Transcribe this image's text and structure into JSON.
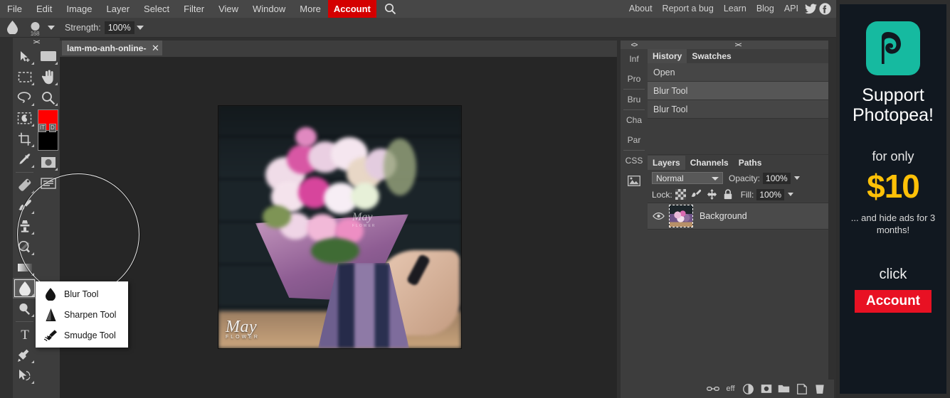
{
  "menubar": {
    "items": [
      "File",
      "Edit",
      "Image",
      "Layer",
      "Select",
      "Filter",
      "View",
      "Window",
      "More"
    ],
    "account_label": "Account",
    "search_icon": "search-icon",
    "right_links": [
      "About",
      "Report a bug",
      "Learn",
      "Blog",
      "API"
    ],
    "social": [
      "twitter-icon",
      "facebook-icon"
    ],
    "accent_red": "#d40000"
  },
  "options_bar": {
    "tool_icon": "blur-drop-icon",
    "brush_size": "168",
    "brush_preview_icon": "brush-circle-icon",
    "strength_label": "Strength:",
    "strength_value": "100%"
  },
  "toolbar": {
    "collapse_glyph": "><",
    "tools": [
      {
        "name": "move-tool",
        "icon": "arrow-move-icon",
        "selected": false
      },
      {
        "name": "artboard-tool",
        "icon": "rectangle-icon",
        "selected": false
      },
      {
        "name": "rectangular-marquee-tool",
        "icon": "dashed-rectangle-icon",
        "selected": false
      },
      {
        "name": "hand-tool",
        "icon": "hand-icon",
        "selected": false
      },
      {
        "name": "lasso-tool",
        "icon": "lasso-icon",
        "selected": false
      },
      {
        "name": "zoom-tool",
        "icon": "magnifier-icon",
        "selected": false
      },
      {
        "name": "object-selection-tool",
        "icon": "object-select-icon",
        "selected": false
      },
      {
        "name": "crop-tool",
        "icon": "crop-icon",
        "selected": false
      },
      {
        "name": "eyedropper-tool",
        "icon": "eyedropper-icon",
        "selected": false
      },
      {
        "name": "shape-tool",
        "icon": "shape-circle-icon",
        "selected": false
      },
      {
        "name": "text-block-tool",
        "icon": "text-lines-icon",
        "selected": false
      },
      {
        "name": "eraser-tool",
        "icon": "eraser-icon",
        "selected": false
      },
      {
        "name": "brush-tool",
        "icon": "paintbrush-icon",
        "selected": false
      },
      {
        "name": "clone-stamp-tool",
        "icon": "stamp-icon",
        "selected": false
      },
      {
        "name": "dodge-tool",
        "icon": "dodge-icon",
        "selected": false
      },
      {
        "name": "gradient-tool",
        "icon": "gradient-icon",
        "selected": false
      },
      {
        "name": "blur-tool",
        "icon": "blur-drop-icon",
        "selected": true
      },
      {
        "name": "burn-tool",
        "icon": "burn-icon",
        "selected": false
      },
      {
        "name": "type-tool",
        "icon": "type-T-icon",
        "selected": false
      },
      {
        "name": "pen-tool",
        "icon": "pen-icon",
        "selected": false
      },
      {
        "name": "path-selection-tool",
        "icon": "path-arrow-icon",
        "selected": false
      }
    ],
    "foreground_color": "#ff0000",
    "background_color": "#000000",
    "swatch_labels": [
      "IT",
      "D"
    ]
  },
  "tool_flyout": {
    "items": [
      {
        "label": "Blur Tool",
        "icon": "blur-drop-icon"
      },
      {
        "label": "Sharpen Tool",
        "icon": "sharpen-triangle-icon"
      },
      {
        "label": "Smudge Tool",
        "icon": "smudge-finger-icon"
      }
    ]
  },
  "document": {
    "tab_label": "lam-mo-anh-online-g",
    "close_glyph": "✕",
    "watermark_main": "May",
    "watermark_sub": "FLOWER",
    "watermark_secondary": "May",
    "watermark_secondary_sub": "FLOWER"
  },
  "rail": {
    "collapse_glyph": "<>",
    "items": [
      "Inf",
      "Pro",
      "Bru",
      "Cha",
      "Par",
      "CSS"
    ],
    "image_icon": "image-thumbnail-icon"
  },
  "history_panel": {
    "collapse_glyph": "><",
    "tabs": [
      {
        "label": "History",
        "active": true
      },
      {
        "label": "Swatches",
        "active": false
      }
    ],
    "entries": [
      {
        "label": "Open",
        "current": false
      },
      {
        "label": "Blur Tool",
        "current": true
      },
      {
        "label": "Blur Tool",
        "current": false
      }
    ]
  },
  "layers_panel": {
    "tabs": [
      {
        "label": "Layers",
        "active": true
      },
      {
        "label": "Channels",
        "active": false
      },
      {
        "label": "Paths",
        "active": false
      }
    ],
    "blend_mode": "Normal",
    "opacity_label": "Opacity:",
    "opacity_value": "100%",
    "lock_label": "Lock:",
    "lock_icons": [
      "checker-transparency-icon",
      "paintbrush-lock-icon",
      "move-lock-icon",
      "padlock-icon"
    ],
    "fill_label": "Fill:",
    "fill_value": "100%",
    "layers": [
      {
        "name": "Background",
        "visible": true,
        "thumbnail": "flower-bouquet-thumbnail"
      }
    ],
    "bottom_icons": [
      {
        "name": "link-layers-icon",
        "glyph": "⚭"
      },
      {
        "name": "layer-effects-icon",
        "glyph": "eff"
      },
      {
        "name": "adjustment-layer-icon",
        "glyph": "half-circle"
      },
      {
        "name": "layer-mask-icon",
        "glyph": "mask-square"
      },
      {
        "name": "new-group-icon",
        "glyph": "folder"
      },
      {
        "name": "new-layer-icon",
        "glyph": "page"
      },
      {
        "name": "delete-layer-icon",
        "glyph": "trash"
      }
    ]
  },
  "ad_panel": {
    "logo_icon": "photopea-logo-icon",
    "logo_color": "#16baa0",
    "title": "Support Photopea!",
    "subtitle": "for only",
    "price": "$10",
    "price_color": "#ffc107",
    "note": "... and hide ads for 3 months!",
    "click_label": "click",
    "button_label": "Account",
    "button_color": "#e81123"
  }
}
